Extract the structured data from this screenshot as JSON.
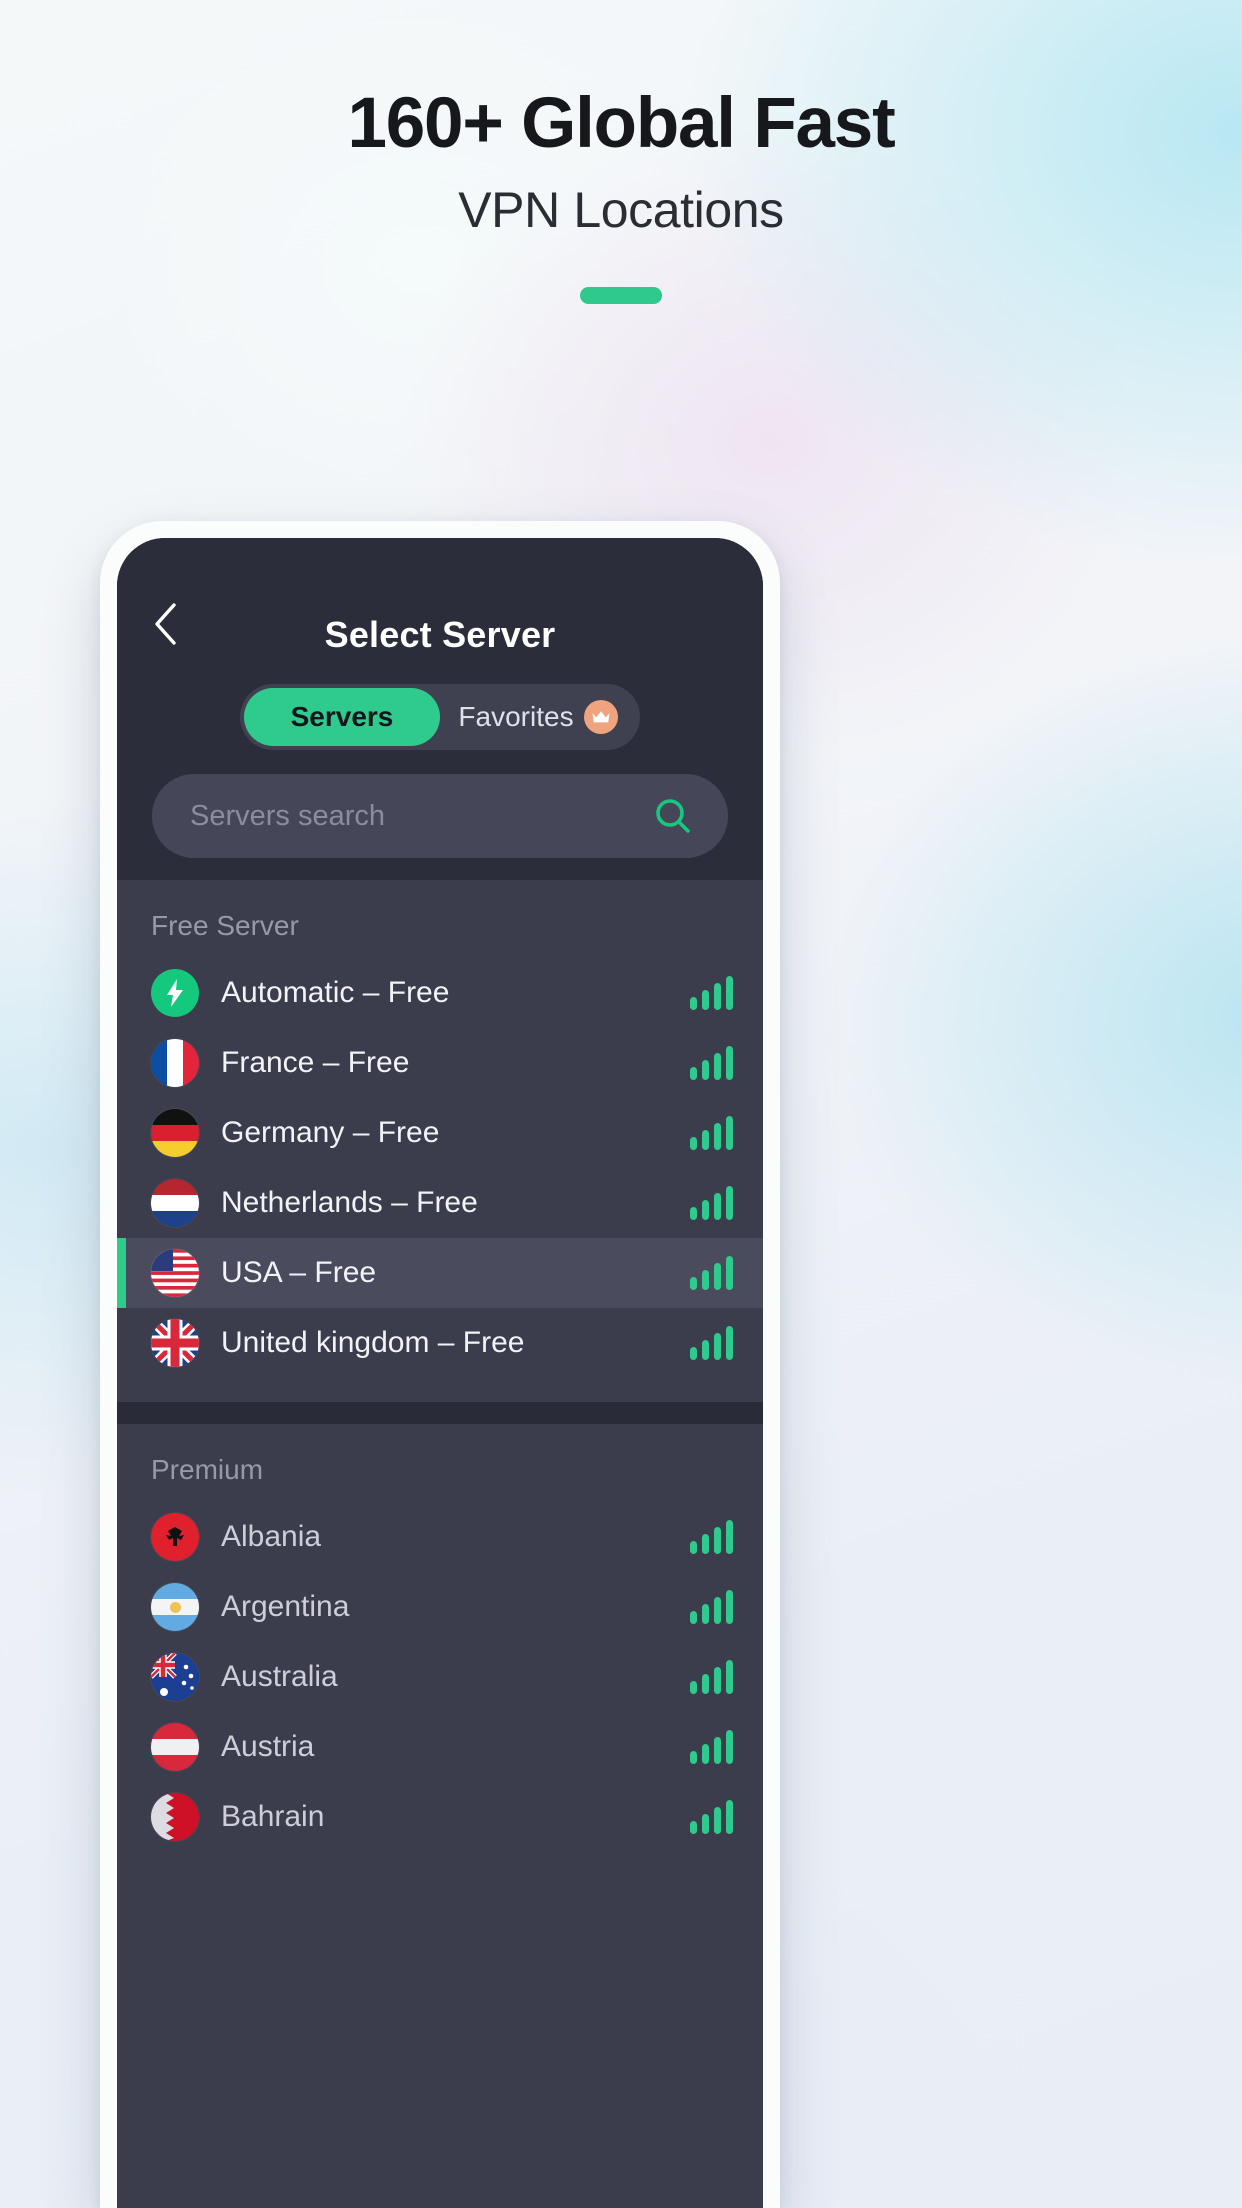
{
  "hero": {
    "title": "160+ Global Fast",
    "subtitle": "VPN Locations"
  },
  "colors": {
    "accent_green": "#2ecb8d",
    "crown_badge": "#efa47d",
    "screen_bg": "#3b3c4c",
    "header_bg": "#2c2d3b",
    "row_selected_bg": "#4a4b5d"
  },
  "app": {
    "nav": {
      "back_icon": "chevron-left-icon",
      "title": "Select Server"
    },
    "tabs": [
      {
        "label": "Servers",
        "active": true,
        "badge_icon": null
      },
      {
        "label": "Favorites",
        "active": false,
        "badge_icon": "crown-icon"
      }
    ],
    "search": {
      "placeholder": "Servers search",
      "value": "",
      "icon": "search-icon"
    },
    "sections": [
      {
        "title": "Free Server",
        "rows": [
          {
            "label": "Automatic – Free",
            "icon": "bolt-icon",
            "signal": 4,
            "selected": false,
            "premium": false
          },
          {
            "label": "France – Free",
            "icon": "flag-france",
            "signal": 4,
            "selected": false,
            "premium": false
          },
          {
            "label": "Germany – Free",
            "icon": "flag-germany",
            "signal": 4,
            "selected": false,
            "premium": false
          },
          {
            "label": "Netherlands – Free",
            "icon": "flag-netherlands",
            "signal": 4,
            "selected": false,
            "premium": false
          },
          {
            "label": "USA – Free",
            "icon": "flag-usa",
            "signal": 4,
            "selected": true,
            "premium": false
          },
          {
            "label": "United kingdom – Free",
            "icon": "flag-uk",
            "signal": 4,
            "selected": false,
            "premium": false
          }
        ]
      },
      {
        "title": "Premium",
        "rows": [
          {
            "label": "Albania",
            "icon": "flag-albania",
            "signal": 4,
            "selected": false,
            "premium": true
          },
          {
            "label": "Argentina",
            "icon": "flag-argentina",
            "signal": 4,
            "selected": false,
            "premium": true
          },
          {
            "label": "Australia",
            "icon": "flag-australia",
            "signal": 4,
            "selected": false,
            "premium": true
          },
          {
            "label": "Austria",
            "icon": "flag-austria",
            "signal": 4,
            "selected": false,
            "premium": true
          },
          {
            "label": "Bahrain",
            "icon": "flag-bahrain",
            "signal": 4,
            "selected": false,
            "premium": true
          }
        ]
      }
    ]
  }
}
